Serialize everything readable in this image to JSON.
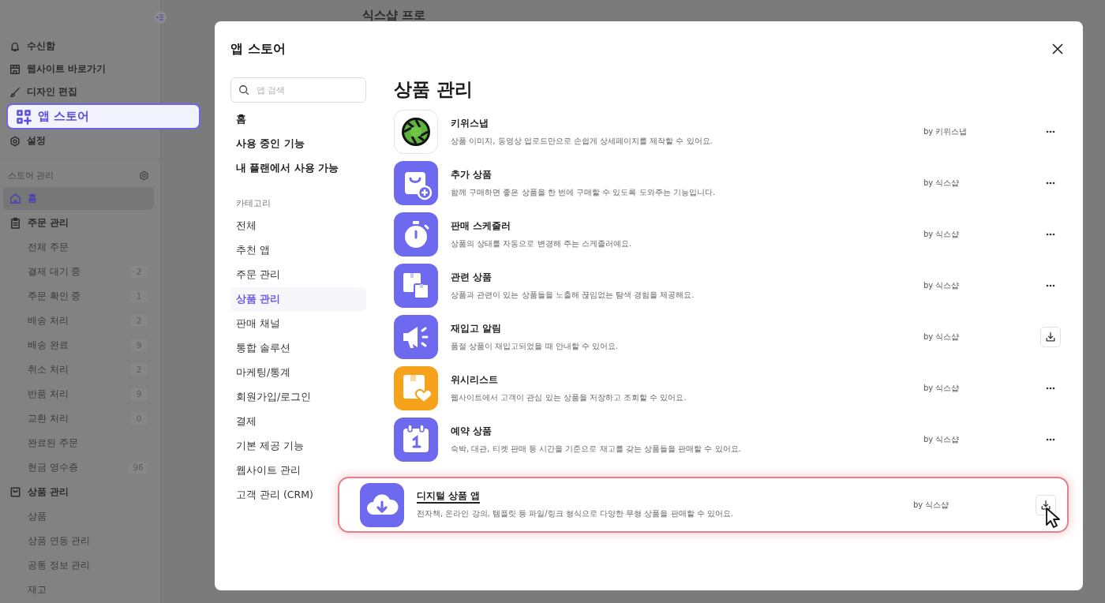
{
  "background": {
    "page_title": "식스샵 프로",
    "sidebar": {
      "top_links": [
        {
          "label": "수신함",
          "highlighted": false
        },
        {
          "label": "웹사이트 바로가기",
          "highlighted": false
        },
        {
          "label": "디자인 편집",
          "highlighted": false
        },
        {
          "label": "앱 스토어",
          "highlighted": true
        },
        {
          "label": "설정",
          "highlighted": false
        }
      ],
      "store_menu": {
        "title": "스토어 관리",
        "items": [
          {
            "label": "홈",
            "selected": true
          },
          {
            "label": "주문 관리",
            "selected": false,
            "children": [
              {
                "label": "전체 주문",
                "selected": false
              },
              {
                "label": "결제 대기 중",
                "count": "2",
                "selected": false
              },
              {
                "label": "주문 확인 중",
                "count": "1",
                "selected": false
              },
              {
                "label": "배송 처리",
                "count": "2",
                "selected": false
              },
              {
                "label": "배송 완료",
                "count": "9",
                "selected": false
              },
              {
                "label": "취소 처리",
                "count": "2",
                "selected": false
              },
              {
                "label": "반품 처리",
                "count": "9",
                "selected": false
              },
              {
                "label": "교환 처리",
                "count": "0",
                "selected": false
              },
              {
                "label": "완료된 주문",
                "selected": false
              },
              {
                "label": "현금 영수증",
                "count": "96",
                "selected": false
              }
            ]
          },
          {
            "label": "상품 관리",
            "selected": false,
            "children": [
              {
                "label": "상품",
                "selected": false
              },
              {
                "label": "상품 연동 관리",
                "selected": false
              },
              {
                "label": "공통 정보 관리",
                "selected": false
              },
              {
                "label": "재고",
                "selected": false
              }
            ]
          }
        ]
      }
    }
  },
  "modal": {
    "title": "앱 스토어",
    "search": {
      "placeholder": "앱 검색"
    },
    "top_items": [
      {
        "label": "홈",
        "selected": false
      },
      {
        "label": "사용 중인 기능",
        "selected": false
      },
      {
        "label": "내 플랜에서 사용 가능",
        "selected": false
      }
    ],
    "category_title": "카테고리",
    "categories": [
      {
        "label": "전체",
        "selected": false
      },
      {
        "label": "추천 앱",
        "selected": false
      },
      {
        "label": "주문 관리",
        "selected": false
      },
      {
        "label": "상품 관리",
        "selected": true
      },
      {
        "label": "판매 채널",
        "selected": false
      },
      {
        "label": "통합 솔루션",
        "selected": false
      },
      {
        "label": "마케팅/통계",
        "selected": false
      },
      {
        "label": "회원가입/로그인",
        "selected": false
      },
      {
        "label": "결제",
        "selected": false
      },
      {
        "label": "기본 제공 기능",
        "selected": false
      },
      {
        "label": "웹사이트 관리",
        "selected": false
      },
      {
        "label": "고객 관리 (CRM)",
        "selected": false
      }
    ],
    "heading": "상품 관리",
    "apps": [
      {
        "title": "키위스냅",
        "description": "상품 이미지, 동영상 업로드만으로 손쉽게 상세페이지를 제작할 수 있어요.",
        "author": "by 키위스냅",
        "kind": "more",
        "highlighted": false
      },
      {
        "title": "추가 상품",
        "description": "함께 구매하면 좋은 상품을 한 번에 구매할 수 있도록 도와주는 기능입니다.",
        "author": "by 식스샵",
        "kind": "more",
        "highlighted": false
      },
      {
        "title": "판매 스케줄러",
        "description": "상품의 상태를 자동으로 변경해 주는 스케줄러예요.",
        "author": "by 식스샵",
        "kind": "more",
        "highlighted": false
      },
      {
        "title": "관련 상품",
        "description": "상품과 관련이 있는 상품들을 노출해 끊임없는 탐색 경험을 제공해요.",
        "author": "by 식스샵",
        "kind": "more",
        "highlighted": false
      },
      {
        "title": "재입고 알림",
        "description": "품절 상품이 재입고되었을 때 안내할 수 있어요.",
        "author": "by 식스샵",
        "kind": "install",
        "highlighted": false
      },
      {
        "title": "위시리스트",
        "description": "웹사이트에서 고객이 관심 있는 상품을 저장하고 조회할 수 있어요.",
        "author": "by 식스샵",
        "kind": "more",
        "highlighted": false
      },
      {
        "title": "예약 상품",
        "description": "숙박, 대관, 티켓 판매 등 시간을 기준으로 재고를 갖는 상품들을 판매할 수 있어요.",
        "author": "by 식스샵",
        "kind": "more",
        "highlighted": false
      },
      {
        "title": "디지털 상품 앱",
        "description": "전자책, 온라인 강의, 템플릿 등 파일/링크 형식으로 다양한 무형 상품을 판매할 수 있어요.",
        "author": "by 식스샵",
        "kind": "install",
        "highlighted": true
      }
    ]
  }
}
